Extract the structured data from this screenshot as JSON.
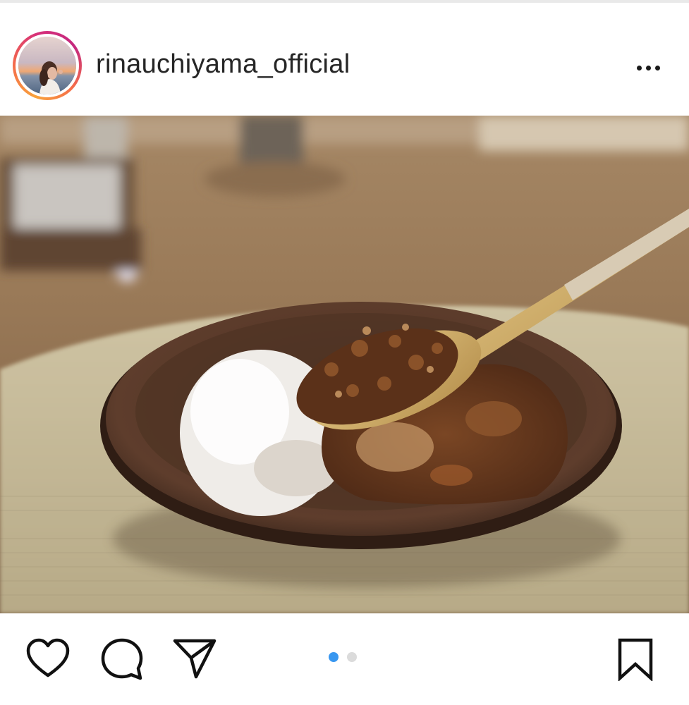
{
  "post": {
    "username": "rinauchiyama_official",
    "carousel": {
      "total": 2,
      "active_index": 0,
      "active_color": "#3897f0",
      "inactive_color": "#dbdbdb"
    }
  },
  "icons": {
    "more": "more-horizontal-icon",
    "like": "heart-icon",
    "comment": "comment-icon",
    "share": "paper-plane-icon",
    "save": "bookmark-icon"
  },
  "colors": {
    "text": "#262626",
    "story_ring_start": "#f9a23b",
    "story_ring_end": "#d62e7a"
  }
}
